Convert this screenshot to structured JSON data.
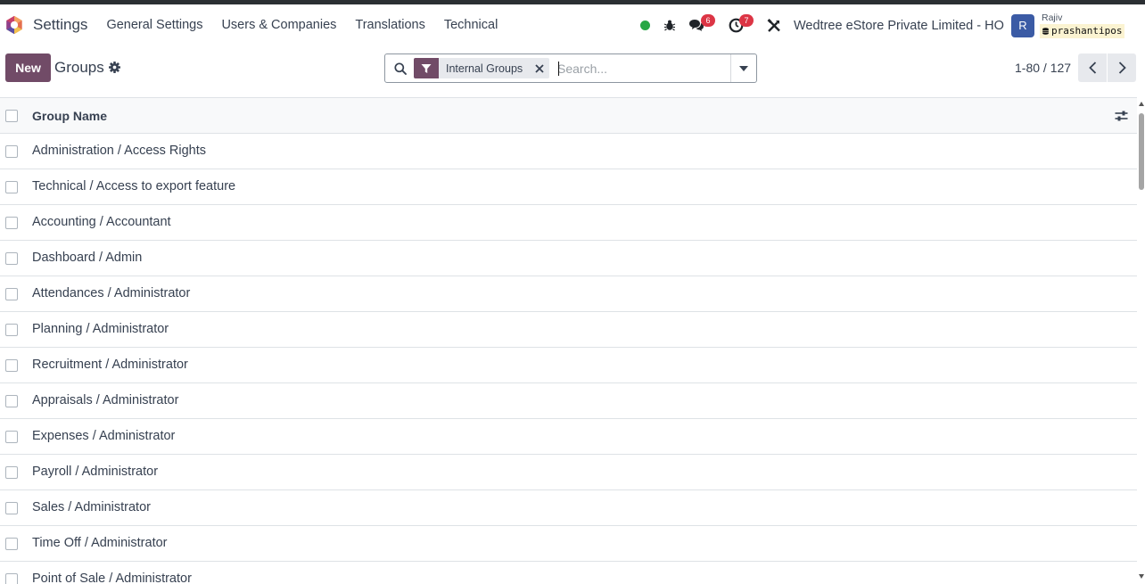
{
  "navbar": {
    "app_name": "Settings",
    "menu": [
      "General Settings",
      "Users & Companies",
      "Translations",
      "Technical"
    ],
    "messages_badge": "6",
    "activities_badge": "7",
    "company": "Wedtree eStore Private Limited - HO",
    "avatar_letter": "R",
    "user_name": "Rajiv",
    "database": "prashantipos",
    "colors": {
      "presence": "#28a745",
      "badge": "#dc3545",
      "avatar": "#3b5ba5"
    }
  },
  "control_panel": {
    "new_label": "New",
    "title": "Groups",
    "search": {
      "facet_label": "Internal Groups",
      "placeholder": "Search..."
    },
    "pager": "1-80 / 127",
    "colors": {
      "primary": "#714b67"
    }
  },
  "list": {
    "column_header": "Group Name",
    "rows": [
      "Administration / Access Rights",
      "Technical / Access to export feature",
      "Accounting / Accountant",
      "Dashboard / Admin",
      "Attendances / Administrator",
      "Planning / Administrator",
      "Recruitment / Administrator",
      "Appraisals / Administrator",
      "Expenses / Administrator",
      "Payroll / Administrator",
      "Sales / Administrator",
      "Time Off / Administrator",
      "Point of Sale / Administrator"
    ]
  }
}
